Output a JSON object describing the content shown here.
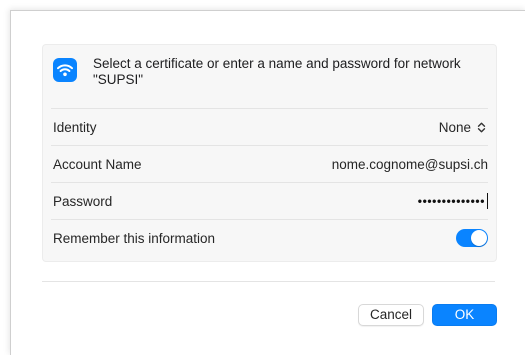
{
  "dialog": {
    "title": "Select a certificate or enter a name and password for network \"SUPSI\"",
    "icon": "wifi-icon"
  },
  "form": {
    "identity": {
      "label": "Identity",
      "value": "None",
      "icon": "chevron-updown-icon"
    },
    "account": {
      "label": "Account Name",
      "value": "nome.cognome@supsi.ch"
    },
    "password": {
      "label": "Password",
      "masked": "••••••••••••••"
    },
    "remember": {
      "label": "Remember this information",
      "enabled": true
    }
  },
  "buttons": {
    "cancel": "Cancel",
    "ok": "OK"
  },
  "colors": {
    "accent": "#0a84ff",
    "panel": "#f7f7f7"
  }
}
